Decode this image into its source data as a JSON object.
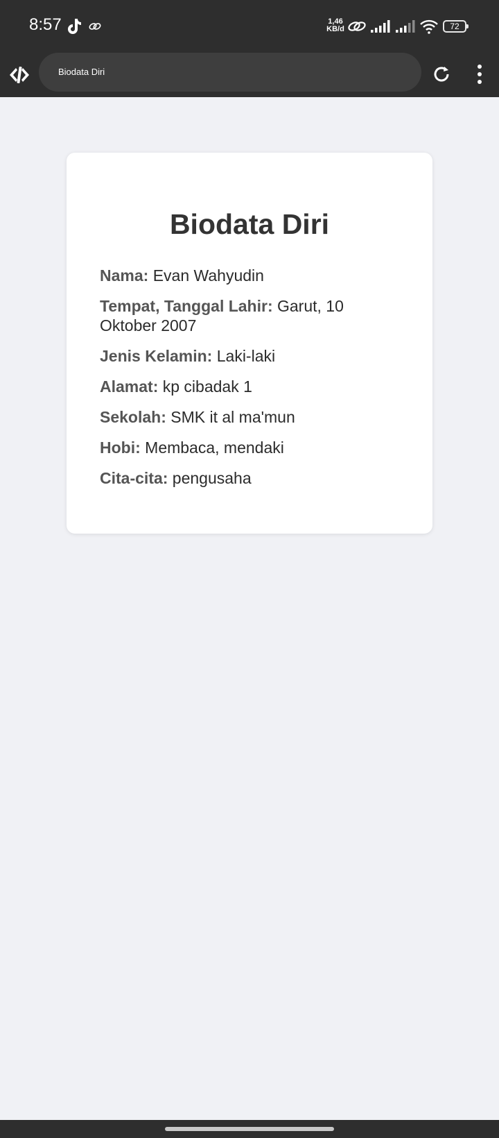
{
  "status_bar": {
    "time": "8:57",
    "network_rate_value": "1,46",
    "network_rate_unit": "KB/d",
    "battery": "72",
    "icons": [
      "tiktok-icon",
      "link-icon",
      "cellular-signal-icon",
      "cellular-signal-icon",
      "wifi-icon",
      "battery-icon"
    ]
  },
  "browser": {
    "tab_title": "Biodata Diri",
    "icons": [
      "app-logo-icon",
      "reload-icon",
      "more-vert-icon"
    ]
  },
  "card": {
    "title": "Biodata Diri",
    "fields": [
      {
        "label": "Nama:",
        "value": "Evan Wahyudin"
      },
      {
        "label": "Tempat, Tanggal Lahir:",
        "value": "Garut, 10 Oktober 2007"
      },
      {
        "label": "Jenis Kelamin:",
        "value": "Laki-laki"
      },
      {
        "label": "Alamat:",
        "value": "kp cibadak 1"
      },
      {
        "label": "Sekolah:",
        "value": "SMK it al ma'mun"
      },
      {
        "label": "Hobi:",
        "value": "Membaca, mendaki"
      },
      {
        "label": "Cita-cita:",
        "value": "pengusaha"
      }
    ]
  },
  "colors": {
    "chrome": "#2e2e2e",
    "urlbar": "#3e3e3e",
    "page_background": "#f0f1f5",
    "card_background": "#ffffff",
    "label_text": "#555555",
    "value_text": "#2b2b2b"
  }
}
